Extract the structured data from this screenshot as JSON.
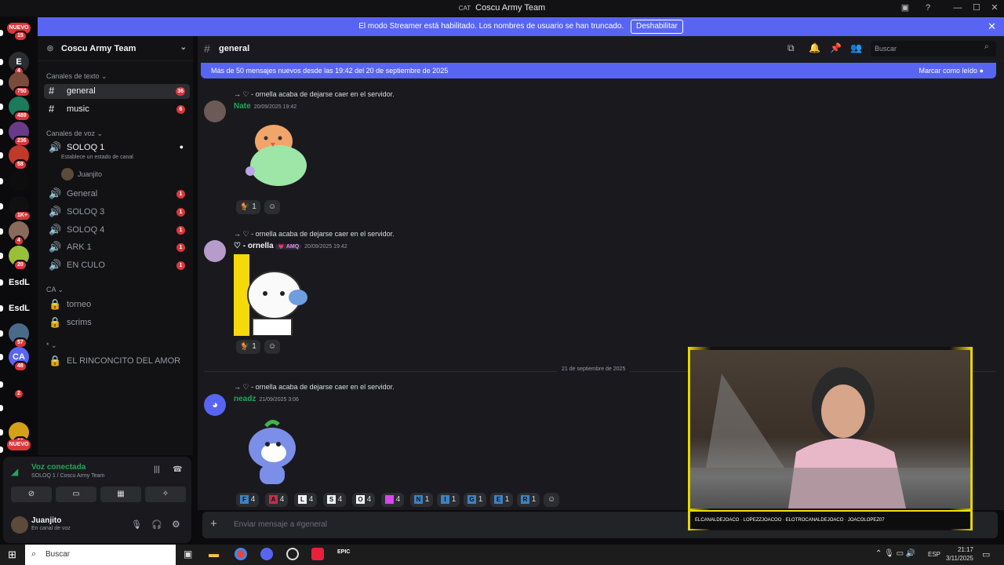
{
  "window": {
    "tag": "CAT",
    "title": "Coscu Army Team"
  },
  "banner": {
    "text": "El modo Streamer está habilitado. Los nombres de usuario se han truncado.",
    "button": "Deshabilitar"
  },
  "servers": [
    {
      "label": "NUEVO",
      "badge": "15"
    },
    {
      "label": "E",
      "badge": "4"
    },
    {
      "label": "",
      "badge": "750"
    },
    {
      "label": "",
      "badge": "489"
    },
    {
      "label": "",
      "badge": "236"
    },
    {
      "label": "",
      "badge": "58"
    },
    {
      "label": "",
      "badge": ""
    },
    {
      "label": "",
      "badge": "1K+"
    },
    {
      "label": "",
      "badge": "4"
    },
    {
      "label": "",
      "badge": "20"
    },
    {
      "label": "EsdL",
      "badge": ""
    },
    {
      "label": "EsdL",
      "badge": ""
    },
    {
      "label": "",
      "badge": "57"
    },
    {
      "label": "CA",
      "badge": "48"
    },
    {
      "label": "",
      "badge": "2"
    },
    {
      "label": "",
      "badge": ""
    },
    {
      "label": "",
      "badge": "90"
    },
    {
      "label": "NUEVO",
      "badge": ""
    }
  ],
  "sidebar": {
    "server_name": "Coscu Army Team",
    "cat_text": "Canales de texto",
    "text_channels": [
      {
        "name": "general",
        "count": "36"
      },
      {
        "name": "music",
        "count": "6"
      }
    ],
    "cat_voice": "Canales de voz",
    "voice_active": {
      "name": "SOLOQ 1",
      "status": "Establece un estado de canal",
      "member": "Juanjito"
    },
    "voice_channels": [
      {
        "name": "General",
        "count": "1"
      },
      {
        "name": "SOLOQ 3",
        "count": "1"
      },
      {
        "name": "SOLOQ 4",
        "count": "1"
      },
      {
        "name": "ARK 1",
        "count": "1"
      },
      {
        "name": "EN CULO",
        "count": "1"
      }
    ],
    "cat_ca": "CA",
    "ca_channels": [
      {
        "name": "torneo"
      },
      {
        "name": "scrims"
      }
    ],
    "cat_star": "*",
    "star_channels": [
      {
        "name": "EL RINCONCITO DEL AMOR"
      }
    ]
  },
  "voice": {
    "title": "Voz conectada",
    "sub": "SOLOQ 1 / Coscu Army Team"
  },
  "user": {
    "name": "Juanjito",
    "status": "En canal de voz"
  },
  "header": {
    "channel": "general",
    "search_placeholder": "Buscar"
  },
  "newbar": {
    "text": "Más de 50 mensajes nuevos desde las 19:42 del 20 de septiembre de 2025",
    "action": "Marcar como leído"
  },
  "messages": [
    {
      "sys": "→ ♡ - ornella acaba de dejarse caer en el servidor.",
      "user": "Nate",
      "time": "20/09/2025 19:42",
      "color": "#23a55a",
      "react": "1"
    },
    {
      "sys": "→ ♡ - ornella acaba de dejarse caer en el servidor.",
      "user": "♡ - ornella",
      "tag": "💗 AMQ",
      "time": "20/09/2025 19:42",
      "color": "#f2f3f5",
      "react": "1"
    },
    {
      "sys": "→ ♡ - ornella acaba de dejarse caer en el servidor.",
      "user": "neadz",
      "time": "21/09/2025 3:06",
      "color": "#23a55a"
    }
  ],
  "divider": "21 de septiembre de 2025",
  "reactions3": [
    {
      "l": "F",
      "n": "4"
    },
    {
      "l": "A",
      "n": "4"
    },
    {
      "l": "L",
      "n": "4"
    },
    {
      "l": "S",
      "n": "4"
    },
    {
      "l": "O",
      "n": "4"
    },
    {
      "l": "",
      "n": "4"
    },
    {
      "l": "N",
      "n": "1"
    },
    {
      "l": "I",
      "n": "1"
    },
    {
      "l": "G",
      "n": "1"
    },
    {
      "l": "E",
      "n": "1"
    },
    {
      "l": "R",
      "n": "1"
    }
  ],
  "composer": {
    "placeholder": "Enviar mensaje a #general"
  },
  "cam": {
    "strip": "ELCANALDEJOACO · LOPEZZJOACOO · ELOTROCANALDEJOACO · JOACOLOPEZ07"
  },
  "taskbar": {
    "search": "Buscar",
    "lang": "ESP",
    "time": "21:17",
    "date": "3/11/2025"
  }
}
